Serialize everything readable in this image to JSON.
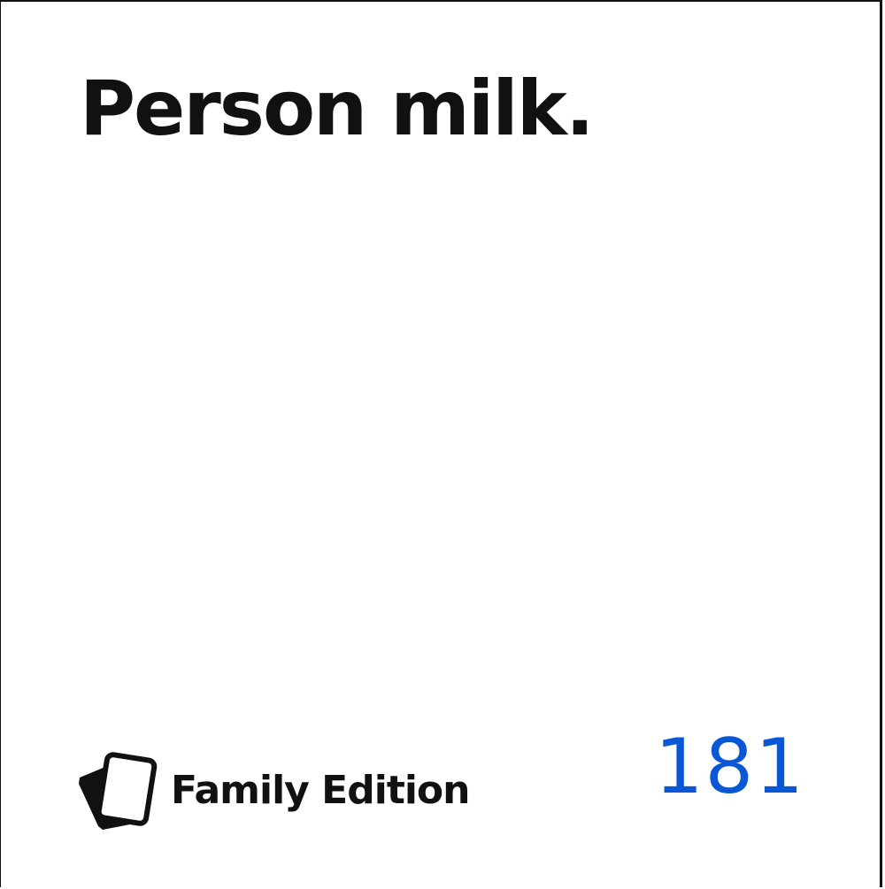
{
  "card": {
    "text": "Person milk.",
    "edition": "Family Edition",
    "number": "181",
    "logo_icon": "stacked-cards-icon",
    "colors": {
      "text": "#111111",
      "number": "#0a57d6",
      "background": "#ffffff"
    }
  }
}
